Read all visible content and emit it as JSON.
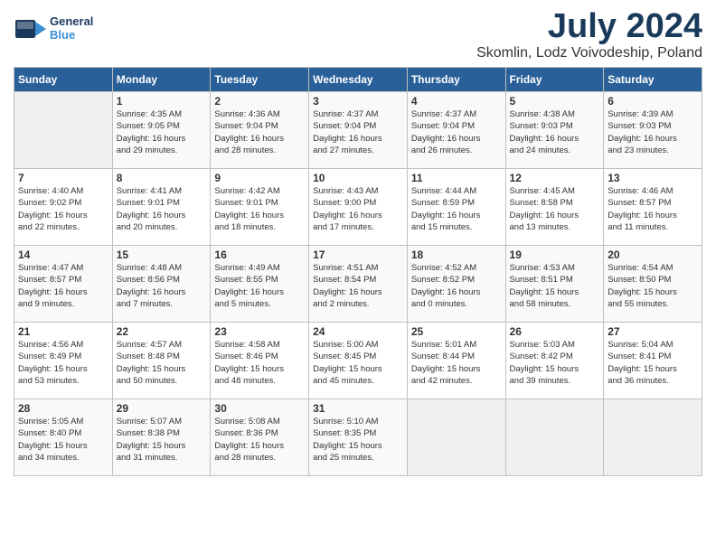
{
  "header": {
    "logo_line1": "General",
    "logo_line2": "Blue",
    "month": "July 2024",
    "location": "Skomlin, Lodz Voivodeship, Poland"
  },
  "days_of_week": [
    "Sunday",
    "Monday",
    "Tuesday",
    "Wednesday",
    "Thursday",
    "Friday",
    "Saturday"
  ],
  "weeks": [
    [
      {
        "day": "",
        "info": ""
      },
      {
        "day": "1",
        "info": "Sunrise: 4:35 AM\nSunset: 9:05 PM\nDaylight: 16 hours\nand 29 minutes."
      },
      {
        "day": "2",
        "info": "Sunrise: 4:36 AM\nSunset: 9:04 PM\nDaylight: 16 hours\nand 28 minutes."
      },
      {
        "day": "3",
        "info": "Sunrise: 4:37 AM\nSunset: 9:04 PM\nDaylight: 16 hours\nand 27 minutes."
      },
      {
        "day": "4",
        "info": "Sunrise: 4:37 AM\nSunset: 9:04 PM\nDaylight: 16 hours\nand 26 minutes."
      },
      {
        "day": "5",
        "info": "Sunrise: 4:38 AM\nSunset: 9:03 PM\nDaylight: 16 hours\nand 24 minutes."
      },
      {
        "day": "6",
        "info": "Sunrise: 4:39 AM\nSunset: 9:03 PM\nDaylight: 16 hours\nand 23 minutes."
      }
    ],
    [
      {
        "day": "7",
        "info": "Sunrise: 4:40 AM\nSunset: 9:02 PM\nDaylight: 16 hours\nand 22 minutes."
      },
      {
        "day": "8",
        "info": "Sunrise: 4:41 AM\nSunset: 9:01 PM\nDaylight: 16 hours\nand 20 minutes."
      },
      {
        "day": "9",
        "info": "Sunrise: 4:42 AM\nSunset: 9:01 PM\nDaylight: 16 hours\nand 18 minutes."
      },
      {
        "day": "10",
        "info": "Sunrise: 4:43 AM\nSunset: 9:00 PM\nDaylight: 16 hours\nand 17 minutes."
      },
      {
        "day": "11",
        "info": "Sunrise: 4:44 AM\nSunset: 8:59 PM\nDaylight: 16 hours\nand 15 minutes."
      },
      {
        "day": "12",
        "info": "Sunrise: 4:45 AM\nSunset: 8:58 PM\nDaylight: 16 hours\nand 13 minutes."
      },
      {
        "day": "13",
        "info": "Sunrise: 4:46 AM\nSunset: 8:57 PM\nDaylight: 16 hours\nand 11 minutes."
      }
    ],
    [
      {
        "day": "14",
        "info": "Sunrise: 4:47 AM\nSunset: 8:57 PM\nDaylight: 16 hours\nand 9 minutes."
      },
      {
        "day": "15",
        "info": "Sunrise: 4:48 AM\nSunset: 8:56 PM\nDaylight: 16 hours\nand 7 minutes."
      },
      {
        "day": "16",
        "info": "Sunrise: 4:49 AM\nSunset: 8:55 PM\nDaylight: 16 hours\nand 5 minutes."
      },
      {
        "day": "17",
        "info": "Sunrise: 4:51 AM\nSunset: 8:54 PM\nDaylight: 16 hours\nand 2 minutes."
      },
      {
        "day": "18",
        "info": "Sunrise: 4:52 AM\nSunset: 8:52 PM\nDaylight: 16 hours\nand 0 minutes."
      },
      {
        "day": "19",
        "info": "Sunrise: 4:53 AM\nSunset: 8:51 PM\nDaylight: 15 hours\nand 58 minutes."
      },
      {
        "day": "20",
        "info": "Sunrise: 4:54 AM\nSunset: 8:50 PM\nDaylight: 15 hours\nand 55 minutes."
      }
    ],
    [
      {
        "day": "21",
        "info": "Sunrise: 4:56 AM\nSunset: 8:49 PM\nDaylight: 15 hours\nand 53 minutes."
      },
      {
        "day": "22",
        "info": "Sunrise: 4:57 AM\nSunset: 8:48 PM\nDaylight: 15 hours\nand 50 minutes."
      },
      {
        "day": "23",
        "info": "Sunrise: 4:58 AM\nSunset: 8:46 PM\nDaylight: 15 hours\nand 48 minutes."
      },
      {
        "day": "24",
        "info": "Sunrise: 5:00 AM\nSunset: 8:45 PM\nDaylight: 15 hours\nand 45 minutes."
      },
      {
        "day": "25",
        "info": "Sunrise: 5:01 AM\nSunset: 8:44 PM\nDaylight: 15 hours\nand 42 minutes."
      },
      {
        "day": "26",
        "info": "Sunrise: 5:03 AM\nSunset: 8:42 PM\nDaylight: 15 hours\nand 39 minutes."
      },
      {
        "day": "27",
        "info": "Sunrise: 5:04 AM\nSunset: 8:41 PM\nDaylight: 15 hours\nand 36 minutes."
      }
    ],
    [
      {
        "day": "28",
        "info": "Sunrise: 5:05 AM\nSunset: 8:40 PM\nDaylight: 15 hours\nand 34 minutes."
      },
      {
        "day": "29",
        "info": "Sunrise: 5:07 AM\nSunset: 8:38 PM\nDaylight: 15 hours\nand 31 minutes."
      },
      {
        "day": "30",
        "info": "Sunrise: 5:08 AM\nSunset: 8:36 PM\nDaylight: 15 hours\nand 28 minutes."
      },
      {
        "day": "31",
        "info": "Sunrise: 5:10 AM\nSunset: 8:35 PM\nDaylight: 15 hours\nand 25 minutes."
      },
      {
        "day": "",
        "info": ""
      },
      {
        "day": "",
        "info": ""
      },
      {
        "day": "",
        "info": ""
      }
    ]
  ]
}
